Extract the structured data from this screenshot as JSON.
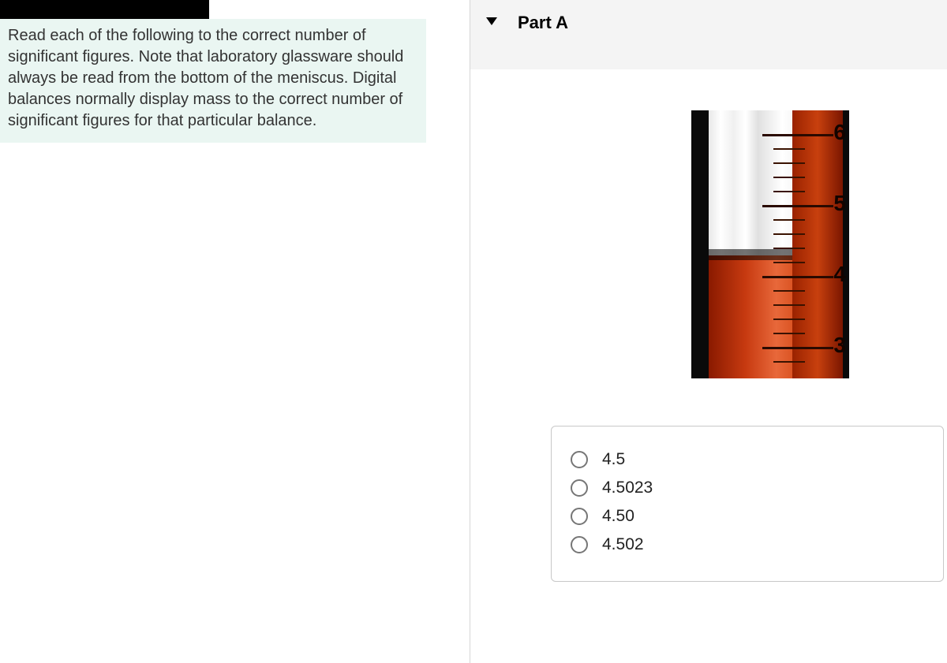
{
  "prompt": "Read each of the following to the correct number of significant figures. Note that laboratory glassware should always be read from the bottom of the meniscus. Digital balance normally display mass to the correct number of significant figures for that particular balance.",
  "prompt_actual": "Read each of the following to the correct number of significant figures. Note that laboratory glassware should always be read from the bottom of the meniscus. Digital balances normally display mass to the correct number of significant figures for that particular balance.",
  "part": {
    "label": "Part A"
  },
  "scale": {
    "numbers": [
      "6",
      "5",
      "4",
      "3"
    ]
  },
  "options": [
    {
      "label": "4.5"
    },
    {
      "label": "4.5023"
    },
    {
      "label": "4.50"
    },
    {
      "label": "4.502"
    }
  ]
}
